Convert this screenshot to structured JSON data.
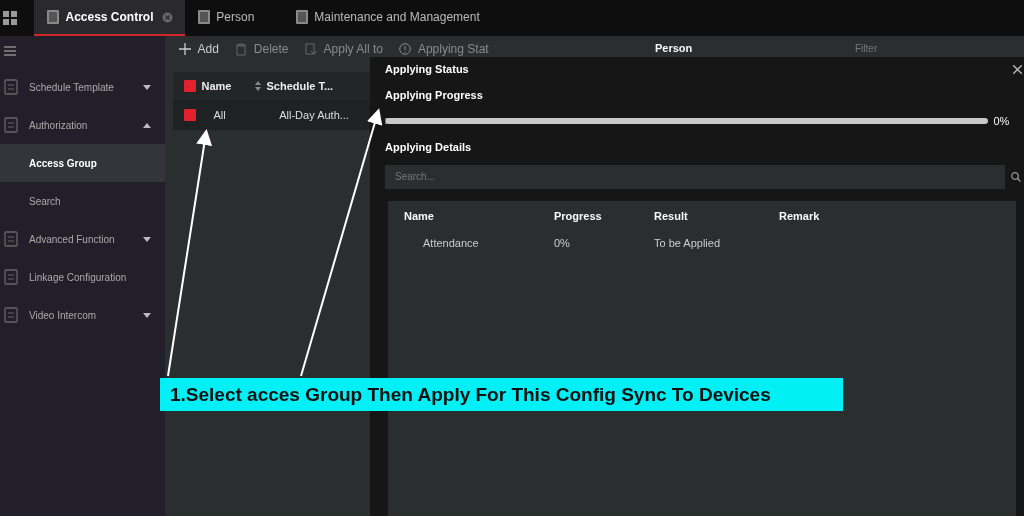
{
  "tabs": [
    {
      "label": "Access Control",
      "selected": true,
      "closable": true
    },
    {
      "label": "Person",
      "selected": false,
      "closable": false
    },
    {
      "label": "Maintenance and Management",
      "selected": false,
      "closable": false
    }
  ],
  "sidebar": {
    "items": [
      {
        "label": "Schedule Template",
        "expanded": false
      },
      {
        "label": "Authorization",
        "expanded": true,
        "children": [
          {
            "label": "Access Group",
            "selected": true
          },
          {
            "label": "Search",
            "selected": false
          }
        ]
      },
      {
        "label": "Advanced Function",
        "expanded": false
      },
      {
        "label": "Linkage Configuration"
      },
      {
        "label": "Video Intercom",
        "expanded": false
      }
    ]
  },
  "toolbar": [
    {
      "label": "Add",
      "kind": "add",
      "disabled": false
    },
    {
      "label": "Delete",
      "kind": "delete",
      "disabled": true
    },
    {
      "label": "Apply All to",
      "kind": "apply",
      "disabled": true
    },
    {
      "label": "Applying Stat",
      "kind": "status",
      "disabled": true
    }
  ],
  "group_table": {
    "columns": [
      "Name",
      "Schedule T..."
    ],
    "all_checked": true,
    "rows": [
      {
        "checked": true,
        "cells": [
          "All",
          "All-Day Auth..."
        ]
      }
    ]
  },
  "person_panel": {
    "title": "Person",
    "filter_placeholder": "Filter"
  },
  "dialog": {
    "title": "Applying Status",
    "progress_label": "Applying Progress",
    "progress": {
      "level": 0,
      "reading": "0%"
    },
    "details_label": "Applying Details",
    "search_placeholder": "Search...",
    "columns": [
      "Name",
      "Progress",
      "Result",
      "Remark"
    ],
    "rows": [
      {
        "cells": [
          "Attendance",
          "0%",
          "To be Applied",
          ""
        ]
      }
    ]
  },
  "annotation": {
    "text": "1.Select acces Group Then Apply For This Config Sync To Devices"
  }
}
